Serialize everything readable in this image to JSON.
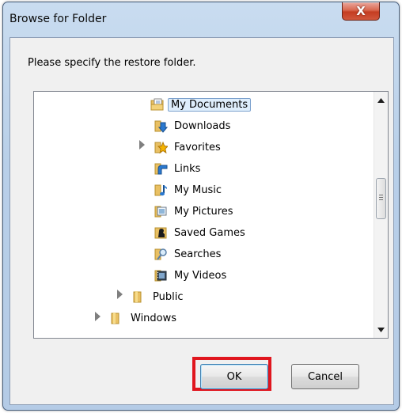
{
  "window": {
    "title": "Browse for Folder",
    "close_glyph": "X"
  },
  "prompt": "Please specify the restore folder.",
  "tree": {
    "items": [
      {
        "label": "My Documents",
        "icon": "documents-folder-icon",
        "selected": true,
        "expandable": false
      },
      {
        "label": "Downloads",
        "icon": "downloads-folder-icon",
        "expandable": false
      },
      {
        "label": "Favorites",
        "icon": "favorites-folder-icon",
        "expandable": true
      },
      {
        "label": "Links",
        "icon": "links-folder-icon",
        "expandable": false
      },
      {
        "label": "My Music",
        "icon": "music-folder-icon",
        "expandable": false
      },
      {
        "label": "My Pictures",
        "icon": "pictures-folder-icon",
        "expandable": false
      },
      {
        "label": "Saved Games",
        "icon": "saved-games-folder-icon",
        "expandable": false
      },
      {
        "label": "Searches",
        "icon": "searches-folder-icon",
        "expandable": false
      },
      {
        "label": "My Videos",
        "icon": "videos-folder-icon",
        "expandable": false
      },
      {
        "label": "Public",
        "icon": "folder-icon",
        "expandable": true
      },
      {
        "label": "Windows",
        "icon": "folder-icon",
        "expandable": true
      }
    ]
  },
  "buttons": {
    "ok": "OK",
    "cancel": "Cancel"
  },
  "colors": {
    "highlight": "#e0161e",
    "selection_bg": "#dfeefc",
    "title_bar": "#b8cfe8"
  }
}
